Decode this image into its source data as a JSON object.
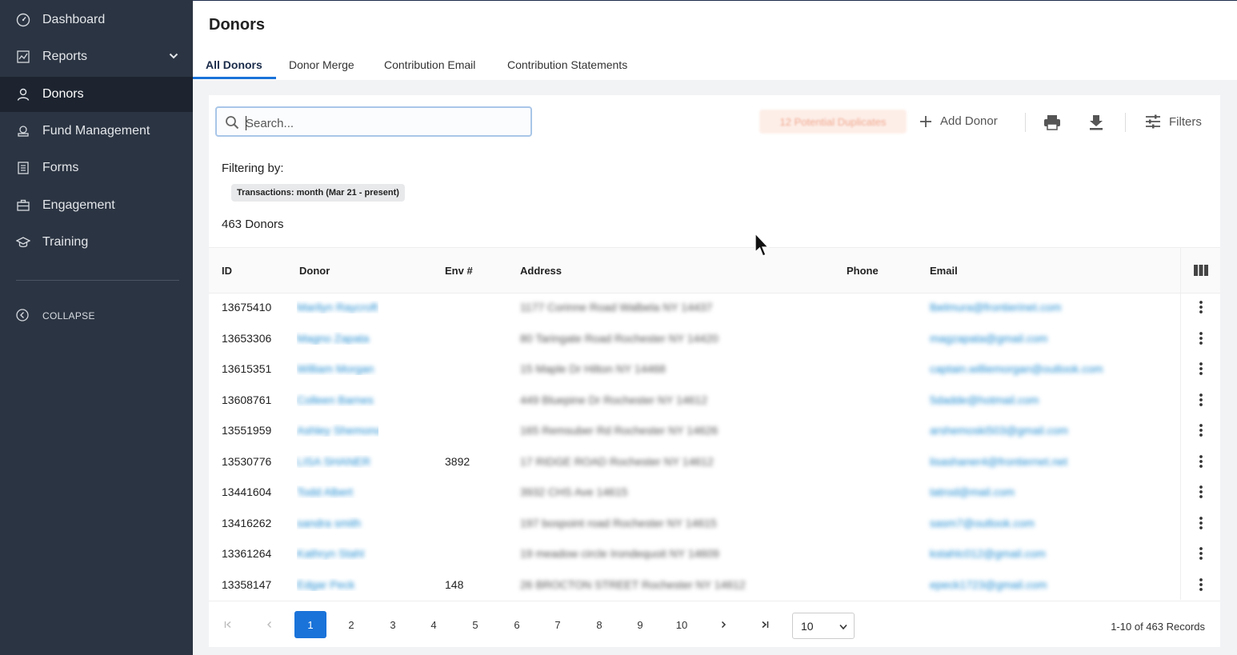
{
  "sidebar": {
    "items": [
      {
        "label": "Dashboard",
        "icon": "dashboard-icon"
      },
      {
        "label": "Reports",
        "icon": "chart-icon"
      },
      {
        "label": "Donors",
        "icon": "person-icon"
      },
      {
        "label": "Fund Management",
        "icon": "fund-icon"
      },
      {
        "label": "Forms",
        "icon": "forms-icon"
      },
      {
        "label": "Engagement",
        "icon": "briefcase-icon"
      },
      {
        "label": "Training",
        "icon": "graduation-cap-icon"
      }
    ],
    "collapse_label": "COLLAPSE"
  },
  "header": {
    "title": "Donors",
    "tabs": [
      "All Donors",
      "Donor Merge",
      "Contribution Email",
      "Contribution Statements"
    ]
  },
  "toolbar": {
    "search_placeholder": "Search...",
    "duplicates_label": "12 Potential Duplicates",
    "add_donor_label": "Add Donor",
    "filters_label": "Filters"
  },
  "filter": {
    "label": "Filtering by:",
    "chip": "Transactions: month (Mar 21 - present)"
  },
  "donor_count": "463 Donors",
  "table": {
    "columns": [
      "ID",
      "Donor",
      "Env #",
      "Address",
      "Phone",
      "Email"
    ],
    "rows": [
      {
        "id": "13675410",
        "donor": "Marilyn Raycroft",
        "env": "",
        "address": "1177 Corinne Road Walbela NY 14437",
        "phone": "",
        "email": "lbelmura@frontierinet.com"
      },
      {
        "id": "13653306",
        "donor": "Magno Zapata",
        "env": "",
        "address": "80 Taringate Road Rochester NY 14420",
        "phone": "",
        "email": "magzapata@gmail.com"
      },
      {
        "id": "13615351",
        "donor": "William Morgan",
        "env": "",
        "address": "15 Maple Dr Hilton NY 14468",
        "phone": "",
        "email": "captain.williemorgan@outlook.com"
      },
      {
        "id": "13608761",
        "donor": "Colleen Barnes",
        "env": "",
        "address": "449 Bluepine Dr Rochester NY 14612",
        "phone": "",
        "email": "5dadde@hotmail.com"
      },
      {
        "id": "13551959",
        "donor": "Ashley Shemonoski",
        "env": "",
        "address": "165 Remsuber Rd Rochester NY 14626",
        "phone": "",
        "email": "arshemoski503@gmail.com"
      },
      {
        "id": "13530776",
        "donor": "LISA SHANER",
        "env": "3892",
        "address": "17 RIDGE ROAD Rochester NY 14612",
        "phone": "",
        "email": "lisashaner4@frontiernet.net"
      },
      {
        "id": "13441604",
        "donor": "Todd Albert",
        "env": "",
        "address": "3932 CHS Ave 14615",
        "phone": "",
        "email": "tatrod@mail.com"
      },
      {
        "id": "13416262",
        "donor": "sandra smith",
        "env": "",
        "address": "197 bospoint road Rochester NY 14615",
        "phone": "",
        "email": "sasm7@outlook.com"
      },
      {
        "id": "13361264",
        "donor": "Kathryn Stahl",
        "env": "",
        "address": "19 meadow circle Irondequoit NY 14609",
        "phone": "",
        "email": "kstahlc012@gmail.com"
      },
      {
        "id": "13358147",
        "donor": "Edgar Peck",
        "env": "148",
        "address": "26 BROCTON STREET Rochester NY 14612",
        "phone": "",
        "email": "epeck1723@gmail.com"
      }
    ]
  },
  "pagination": {
    "pages": [
      "1",
      "2",
      "3",
      "4",
      "5",
      "6",
      "7",
      "8",
      "9",
      "10"
    ],
    "current": "1",
    "page_size": "10",
    "records_text": "1-10 of 463 Records"
  },
  "colors": {
    "sidebar_bg": "#2b3442",
    "accent": "#1a73d9",
    "link": "#1d8ad0"
  }
}
